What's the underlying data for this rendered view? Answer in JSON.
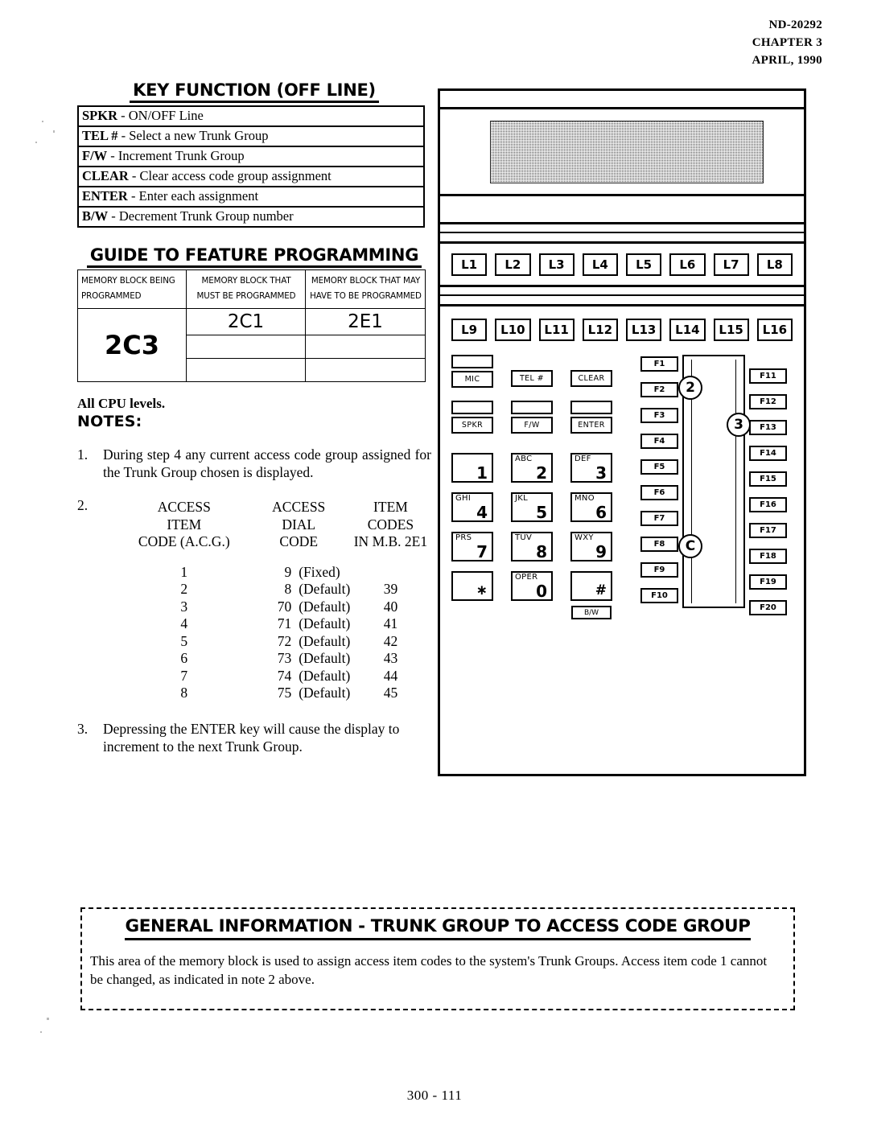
{
  "header": {
    "doc_number": "ND-20292",
    "chapter": "CHAPTER 3",
    "date": "APRIL, 1990"
  },
  "key_function": {
    "title": "KEY FUNCTION (OFF LINE)",
    "rows": [
      {
        "key": "SPKR",
        "sep": "-",
        "desc": "ON/OFF Line"
      },
      {
        "key": "TEL #",
        "sep": "-",
        "desc": "Select a new Trunk Group"
      },
      {
        "key": "F/W",
        "sep": "-",
        "desc": "Increment Trunk Group"
      },
      {
        "key": "CLEAR",
        "sep": "-",
        "desc": "Clear access code group assignment"
      },
      {
        "key": "ENTER",
        "sep": "-",
        "desc": "Enter each assignment"
      },
      {
        "key": "B/W",
        "sep": "-",
        "desc": "Decrement Trunk Group number"
      }
    ]
  },
  "guide": {
    "title": "GUIDE TO FEATURE PROGRAMMING",
    "headers": [
      "MEMORY BLOCK BEING PROGRAMMED",
      "MEMORY BLOCK THAT MUST BE PROGRAMMED",
      "MEMORY BLOCK THAT MAY HAVE TO BE PROGRAMMED"
    ],
    "header_lines": [
      [
        "MEMORY BLOCK BEING",
        "PROGRAMMED"
      ],
      [
        "MEMORY BLOCK THAT",
        "MUST BE PROGRAMMED"
      ],
      [
        "MEMORY BLOCK THAT MAY",
        "HAVE TO BE PROGRAMMED"
      ]
    ],
    "memory_block": "2C3",
    "must_be_programmed": "2C1",
    "may_have_to_be_programmed": "2E1"
  },
  "notes": {
    "cpu_levels": "All CPU levels.",
    "label": "NOTES:",
    "note1": {
      "number": "1.",
      "text": "During step 4 any current access code group assigned for the Trunk Group chosen is displayed."
    },
    "note2": {
      "number": "2.",
      "headers": {
        "item": [
          "ACCESS",
          "ITEM",
          "CODE (A.C.G.)"
        ],
        "dial": [
          "ACCESS",
          "DIAL",
          "CODE"
        ],
        "codes": [
          "ITEM",
          "CODES",
          "IN M.B. 2E1"
        ]
      },
      "rows": [
        {
          "item": "1",
          "dial": "9",
          "tag": "(Fixed)",
          "codes": ""
        },
        {
          "item": "2",
          "dial": "8",
          "tag": "(Default)",
          "codes": "39"
        },
        {
          "item": "3",
          "dial": "70",
          "tag": "(Default)",
          "codes": "40"
        },
        {
          "item": "4",
          "dial": "71",
          "tag": "(Default)",
          "codes": "41"
        },
        {
          "item": "5",
          "dial": "72",
          "tag": "(Default)",
          "codes": "42"
        },
        {
          "item": "6",
          "dial": "73",
          "tag": "(Default)",
          "codes": "43"
        },
        {
          "item": "7",
          "dial": "74",
          "tag": "(Default)",
          "codes": "44"
        },
        {
          "item": "8",
          "dial": "75",
          "tag": "(Default)",
          "codes": "45"
        }
      ]
    },
    "note3": {
      "number": "3.",
      "text": "Depressing the ENTER key will cause the display to  increment to the next Trunk Group."
    }
  },
  "phone": {
    "line_keys_row1": [
      "L1",
      "L2",
      "L3",
      "L4",
      "L5",
      "L6",
      "L7",
      "L8"
    ],
    "line_keys_row2": [
      "L9",
      "L10",
      "L11",
      "L12",
      "L13",
      "L14",
      "L15",
      "L16"
    ],
    "function_keys": [
      "MIC",
      "TEL #",
      "CLEAR",
      "SPKR",
      "F/W",
      "ENTER"
    ],
    "dial_keys": [
      {
        "letters": "",
        "digit": "1"
      },
      {
        "letters": "ABC",
        "digit": "2"
      },
      {
        "letters": "DEF",
        "digit": "3"
      },
      {
        "letters": "GHI",
        "digit": "4"
      },
      {
        "letters": "JKL",
        "digit": "5"
      },
      {
        "letters": "MNO",
        "digit": "6"
      },
      {
        "letters": "PRS",
        "digit": "7"
      },
      {
        "letters": "TUV",
        "digit": "8"
      },
      {
        "letters": "WXY",
        "digit": "9"
      },
      {
        "letters": "",
        "digit": "∗"
      },
      {
        "letters": "OPER",
        "digit": "0"
      },
      {
        "letters": "",
        "digit": "#"
      }
    ],
    "bw_key": "B/W",
    "f_keys_left": [
      "F1",
      "F2",
      "F3",
      "F4",
      "F5",
      "F6",
      "F7",
      "F8",
      "F9",
      "F10"
    ],
    "f_keys_right": [
      "F11",
      "F12",
      "F13",
      "F14",
      "F15",
      "F16",
      "F17",
      "F18",
      "F19",
      "F20"
    ],
    "step_markers": [
      "2",
      "3",
      "C"
    ]
  },
  "general_info": {
    "title": "GENERAL INFORMATION  -  TRUNK GROUP TO ACCESS CODE GROUP",
    "body": "This area of the memory block is used to assign access item codes to the system's Trunk Groups.  Access item code 1 cannot be changed, as indicated in note 2 above."
  },
  "footer": {
    "page": "300 - 111"
  }
}
